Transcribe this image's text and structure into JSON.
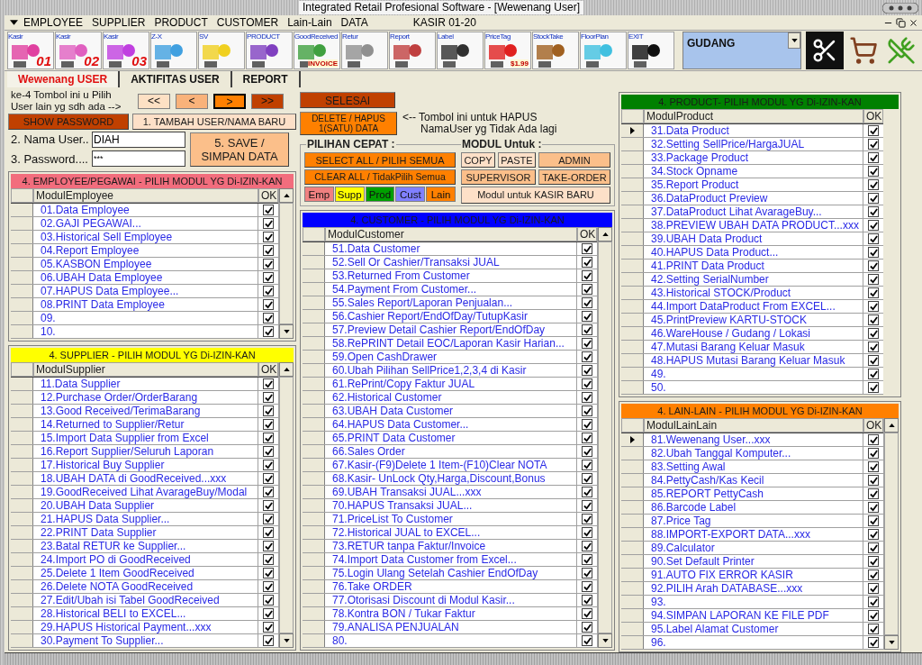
{
  "window": {
    "title": "Integrated Retail Profesional Software - [Wewenang User]"
  },
  "menu": [
    "EMPLOYEE",
    "SUPPLIER",
    "PRODUCT",
    "CUSTOMER",
    "Lain-Lain",
    "DATA"
  ],
  "terminal": "KASIR 01-20",
  "toolbar": [
    {
      "label": "Kasir",
      "number": "01"
    },
    {
      "label": "Kasir",
      "number": "02"
    },
    {
      "label": "Kasir",
      "number": "03"
    },
    {
      "label": "Z-X"
    },
    {
      "label": "SV"
    },
    {
      "label": "PRODUCT"
    },
    {
      "label": "GoodReceived",
      "sub": "INVOICE"
    },
    {
      "label": "Retur"
    },
    {
      "label": "Report"
    },
    {
      "label": "Label"
    },
    {
      "label": "PriceTag",
      "sub": "$1.99"
    },
    {
      "label": "StockTake"
    },
    {
      "label": "FloorPlan"
    },
    {
      "label": "EXIT"
    }
  ],
  "location": {
    "value": "GUDANG"
  },
  "tabs": [
    {
      "label": "Wewenang USER",
      "selected": true
    },
    {
      "label": "AKTIFITAS USER",
      "selected": false
    },
    {
      "label": "REPORT",
      "selected": false
    }
  ],
  "user_form": {
    "hint": "ke-4 Tombol ini u Pilih User lain yg sdh ada -->",
    "nav": [
      {
        "label": "<<",
        "selected": false
      },
      {
        "label": "<",
        "selected": false
      },
      {
        "label": ">",
        "selected": true
      },
      {
        "label": ">>",
        "selected": false
      }
    ],
    "show_password": "SHOW PASSWORD",
    "add_user": "1. TAMBAH USER/NAMA BARU",
    "name_label": "2. Nama User..",
    "name_value": "DIAH",
    "password_label": "3. Password....",
    "password_value": "***",
    "save": "5. SAVE / SIMPAN DATA"
  },
  "actions": {
    "finish": "SELESAI",
    "delete": "DELETE / HAPUS\n1(SATU)  DATA",
    "delete_note": "<-- Tombol ini untuk HAPUS\n      NamaUser yg Tidak Ada lagi"
  },
  "quick": {
    "title": "PILIHAN CEPAT :",
    "select_all": "SELECT ALL / PILIH SEMUA",
    "clear_all": "CLEAR ALL / TidakPilih Semua",
    "filters": [
      {
        "label": "Emp",
        "color": "#f08080"
      },
      {
        "label": "Supp",
        "color": "#ffff00"
      },
      {
        "label": "Prod",
        "color": "#00a000"
      },
      {
        "label": "Cust",
        "color": "#8080ff"
      },
      {
        "label": "Lain",
        "color": "#ff8000"
      }
    ]
  },
  "module_for": {
    "title": "MODUL Untuk :",
    "copy": "COPY",
    "paste": "PASTE",
    "admin": "ADMIN",
    "supervisor": "SUPERVISOR",
    "take_order": "TAKE-ORDER",
    "new_cashier": "Modul untuk KASIR BARU"
  },
  "panels": [
    {
      "title": "4. EMPLOYEE/PEGAWAI  - PILIH MODUL YG Di-IZIN-KAN",
      "color": "#f26d7d",
      "column": "ModulEmployee",
      "ok": "OK",
      "rows": [
        {
          "label": "01.Data Employee",
          "checked": true,
          "selected": false
        },
        {
          "label": "02.GAJI PEGAWAI...",
          "checked": true,
          "selected": false
        },
        {
          "label": "03.Historical Sell Employee",
          "checked": true,
          "selected": false
        },
        {
          "label": "04.Report Employee",
          "checked": true,
          "selected": false
        },
        {
          "label": "05.KASBON Employee",
          "checked": true,
          "selected": false
        },
        {
          "label": "06.UBAH Data Employee",
          "checked": true,
          "selected": false
        },
        {
          "label": "07.HAPUS Data Employee...",
          "checked": true,
          "selected": false
        },
        {
          "label": "08.PRINT Data Employee",
          "checked": true,
          "selected": false
        },
        {
          "label": "09.",
          "checked": true,
          "selected": false
        },
        {
          "label": "10.",
          "checked": true,
          "selected": false
        }
      ]
    },
    {
      "title": "4. SUPPLIER - PILIH MODUL YG Di-IZIN-KAN",
      "color": "#ffff00",
      "column": "ModulSupplier",
      "ok": "OK",
      "rows": [
        {
          "label": "11.Data Supplier",
          "checked": true,
          "selected": false
        },
        {
          "label": "12.Purchase Order/OrderBarang",
          "checked": true,
          "selected": false
        },
        {
          "label": "13.Good Received/TerimaBarang",
          "checked": true,
          "selected": false
        },
        {
          "label": "14.Returned to Supplier/Retur",
          "checked": true,
          "selected": false
        },
        {
          "label": "15.Import Data Supplier from Excel",
          "checked": true,
          "selected": false
        },
        {
          "label": "16.Report Supplier/Seluruh Laporan",
          "checked": true,
          "selected": false
        },
        {
          "label": "17.Historical Buy Supplier",
          "checked": true,
          "selected": false
        },
        {
          "label": "18.UBAH DATA di GoodReceived...xxx",
          "checked": true,
          "selected": false
        },
        {
          "label": "19.GoodReceived Lihat AvarageBuy/Modal",
          "checked": true,
          "selected": false
        },
        {
          "label": "20.UBAH Data Supplier",
          "checked": true,
          "selected": false
        },
        {
          "label": "21.HAPUS Data Supplier...",
          "checked": true,
          "selected": false
        },
        {
          "label": "22.PRINT Data Supplier",
          "checked": true,
          "selected": false
        },
        {
          "label": "23.Batal RETUR ke Supplier...",
          "checked": true,
          "selected": false
        },
        {
          "label": "24.Import PO di GoodReceived",
          "checked": true,
          "selected": false
        },
        {
          "label": "25.Delete 1 Item GoodReceived",
          "checked": true,
          "selected": false
        },
        {
          "label": "26.Delete NOTA GoodReceived",
          "checked": true,
          "selected": false
        },
        {
          "label": "27.Edit/Ubah isi Tabel GoodReceived",
          "checked": true,
          "selected": false
        },
        {
          "label": "28.Historical BELI to EXCEL...",
          "checked": true,
          "selected": false
        },
        {
          "label": "29.HAPUS Historical Payment...xxx",
          "checked": true,
          "selected": false
        },
        {
          "label": "30.Payment To Supplier...",
          "checked": true,
          "selected": false
        }
      ]
    },
    {
      "title": "4. CUSTOMER - PILIH MODUL YG Di-IZIN-KAN",
      "color": "#0000ff",
      "column": "ModulCustomer",
      "ok": "OK",
      "rows": [
        {
          "label": "51.Data Customer",
          "checked": true,
          "selected": false
        },
        {
          "label": "52.Sell Or Cashier/Transaksi JUAL",
          "checked": true,
          "selected": false
        },
        {
          "label": "53.Returned From Customer",
          "checked": true,
          "selected": false
        },
        {
          "label": "54.Payment From Customer...",
          "checked": true,
          "selected": false
        },
        {
          "label": "55.Sales Report/Laporan Penjualan...",
          "checked": true,
          "selected": false
        },
        {
          "label": "56.Cashier Report/EndOfDay/TutupKasir",
          "checked": true,
          "selected": false
        },
        {
          "label": "57.Preview Detail Cashier Report/EndOfDay",
          "checked": true,
          "selected": false
        },
        {
          "label": "58.RePRINT Detail EOC/Laporan Kasir Harian...",
          "checked": true,
          "selected": false
        },
        {
          "label": "59.Open CashDrawer",
          "checked": true,
          "selected": false
        },
        {
          "label": "60.Ubah Pilihan SellPrice1,2,3,4 di Kasir",
          "checked": true,
          "selected": false
        },
        {
          "label": "61.RePrint/Copy Faktur JUAL",
          "checked": true,
          "selected": false
        },
        {
          "label": "62.Historical Customer",
          "checked": true,
          "selected": false
        },
        {
          "label": "63.UBAH Data Customer",
          "checked": true,
          "selected": false
        },
        {
          "label": "64.HAPUS Data Customer...",
          "checked": true,
          "selected": false
        },
        {
          "label": "65.PRINT Data Customer",
          "checked": true,
          "selected": false
        },
        {
          "label": "66.Sales Order",
          "checked": true,
          "selected": false
        },
        {
          "label": "67.Kasir-(F9)Delete 1 Item-(F10)Clear NOTA",
          "checked": true,
          "selected": false
        },
        {
          "label": "68.Kasir- UnLock Qty,Harga,Discount,Bonus",
          "checked": true,
          "selected": false
        },
        {
          "label": "69.UBAH Transaksi JUAL...xxx",
          "checked": true,
          "selected": false
        },
        {
          "label": "70.HAPUS Transaksi JUAL...",
          "checked": true,
          "selected": false
        },
        {
          "label": "71.PriceList To Customer",
          "checked": true,
          "selected": false
        },
        {
          "label": "72.Historical JUAL to EXCEL...",
          "checked": true,
          "selected": false
        },
        {
          "label": "73.RETUR tanpa Faktur/Invoice",
          "checked": true,
          "selected": false
        },
        {
          "label": "74.Import Data Customer from Excel...",
          "checked": true,
          "selected": false
        },
        {
          "label": "75.Login Ulang Setelah Cashier EndOfDay",
          "checked": true,
          "selected": false
        },
        {
          "label": "76.Take ORDER",
          "checked": true,
          "selected": false
        },
        {
          "label": "77.Otorisasi Discount di Modul Kasir...",
          "checked": true,
          "selected": false
        },
        {
          "label": "78.Kontra BON / Tukar Faktur",
          "checked": true,
          "selected": false
        },
        {
          "label": "79.ANALISA PENJUALAN",
          "checked": true,
          "selected": false
        },
        {
          "label": "80.",
          "checked": true,
          "selected": false
        }
      ]
    },
    {
      "title": "4. PRODUCT- PILIH MODUL YG Di-IZIN-KAN",
      "color": "#008000",
      "column": "ModulProduct",
      "ok": "OK",
      "rows": [
        {
          "label": "31.Data Product",
          "checked": true,
          "selected": true
        },
        {
          "label": "32.Setting SellPrice/HargaJUAL",
          "checked": true,
          "selected": false
        },
        {
          "label": "33.Package Product",
          "checked": true,
          "selected": false
        },
        {
          "label": "34.Stock Opname",
          "checked": true,
          "selected": false
        },
        {
          "label": "35.Report Product",
          "checked": true,
          "selected": false
        },
        {
          "label": "36.DataProduct Preview",
          "checked": true,
          "selected": false
        },
        {
          "label": "37.DataProduct Lihat AvarageBuy...",
          "checked": true,
          "selected": false
        },
        {
          "label": "38.PREVIEW UBAH DATA PRODUCT...xxx",
          "checked": true,
          "selected": false
        },
        {
          "label": "39.UBAH Data Product",
          "checked": true,
          "selected": false
        },
        {
          "label": "40.HAPUS Data Product...",
          "checked": true,
          "selected": false
        },
        {
          "label": "41.PRINT Data Product",
          "checked": true,
          "selected": false
        },
        {
          "label": "42.Setting SerialNumber",
          "checked": true,
          "selected": false
        },
        {
          "label": "43.Historical STOCK/Product",
          "checked": true,
          "selected": false
        },
        {
          "label": "44.Import DataProduct From EXCEL...",
          "checked": true,
          "selected": false
        },
        {
          "label": "45.PrintPreview KARTU-STOCK",
          "checked": true,
          "selected": false
        },
        {
          "label": "46.WareHouse / Gudang / Lokasi",
          "checked": true,
          "selected": false
        },
        {
          "label": "47.Mutasi Barang Keluar Masuk",
          "checked": true,
          "selected": false
        },
        {
          "label": "48.HAPUS Mutasi Barang Keluar Masuk",
          "checked": true,
          "selected": false
        },
        {
          "label": "49.",
          "checked": true,
          "selected": false
        },
        {
          "label": "50.",
          "checked": true,
          "selected": false
        }
      ]
    },
    {
      "title": "4. LAIN-LAIN - PILIH MODUL YG Di-IZIN-KAN",
      "color": "#ff8000",
      "column": "ModulLainLain",
      "ok": "OK",
      "rows": [
        {
          "label": "81.Wewenang User...xxx",
          "checked": true,
          "selected": true
        },
        {
          "label": "82.Ubah Tanggal Komputer...",
          "checked": true,
          "selected": false
        },
        {
          "label": "83.Setting Awal",
          "checked": true,
          "selected": false
        },
        {
          "label": "84.PettyCash/Kas Kecil",
          "checked": true,
          "selected": false
        },
        {
          "label": "85.REPORT PettyCash",
          "checked": true,
          "selected": false
        },
        {
          "label": "86.Barcode Label",
          "checked": true,
          "selected": false
        },
        {
          "label": "87.Price Tag",
          "checked": true,
          "selected": false
        },
        {
          "label": "88.IMPORT-EXPORT DATA...xxx",
          "checked": true,
          "selected": false
        },
        {
          "label": "89.Calculator",
          "checked": true,
          "selected": false
        },
        {
          "label": "90.Set Default Printer",
          "checked": true,
          "selected": false
        },
        {
          "label": "91.AUTO FIX ERROR KASIR",
          "checked": true,
          "selected": false
        },
        {
          "label": "92.PILIH Arah DATABASE...xxx",
          "checked": true,
          "selected": false
        },
        {
          "label": "93.",
          "checked": true,
          "selected": false
        },
        {
          "label": "94.SIMPAN LAPORAN KE FILE PDF",
          "checked": true,
          "selected": false
        },
        {
          "label": "95.Label Alamat Customer",
          "checked": true,
          "selected": false
        },
        {
          "label": "96.",
          "checked": true,
          "selected": false
        }
      ]
    }
  ]
}
